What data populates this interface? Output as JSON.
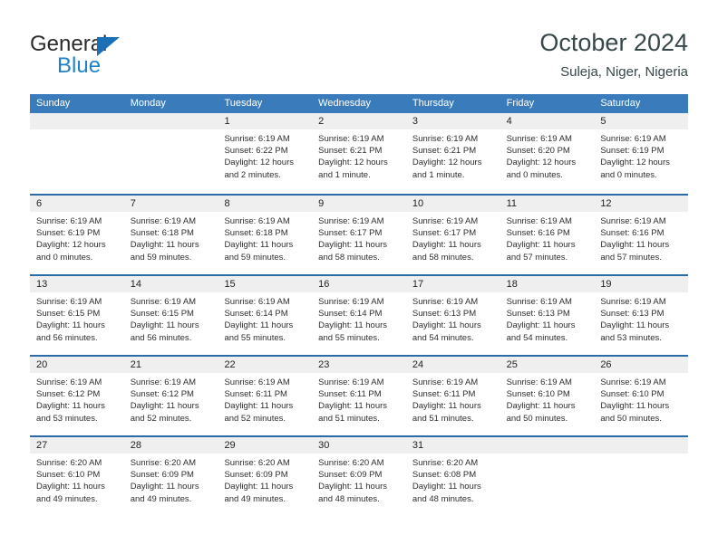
{
  "brand": {
    "name_primary": "General",
    "name_secondary": "Blue",
    "accent_color": "#2081c8",
    "triangle_color": "#1a6fb5"
  },
  "header": {
    "title": "October 2024",
    "location": "Suleja, Niger, Nigeria"
  },
  "theme": {
    "weekday_header_bg": "#3a7cbb",
    "week_divider": "#2b6ca8",
    "day_band_bg": "#efefef"
  },
  "weekdays": [
    "Sunday",
    "Monday",
    "Tuesday",
    "Wednesday",
    "Thursday",
    "Friday",
    "Saturday"
  ],
  "labels": {
    "sunrise_prefix": "Sunrise:",
    "sunset_prefix": "Sunset:",
    "daylight_prefix": "Daylight:"
  },
  "weeks": [
    [
      {
        "day": "",
        "empty": true,
        "line1": "",
        "line2": "",
        "line3": "",
        "line4": ""
      },
      {
        "day": "",
        "empty": true,
        "line1": "",
        "line2": "",
        "line3": "",
        "line4": ""
      },
      {
        "day": "1",
        "empty": false,
        "line1": "Sunrise: 6:19 AM",
        "line2": "Sunset: 6:22 PM",
        "line3": "Daylight: 12 hours",
        "line4": "and 2 minutes."
      },
      {
        "day": "2",
        "empty": false,
        "line1": "Sunrise: 6:19 AM",
        "line2": "Sunset: 6:21 PM",
        "line3": "Daylight: 12 hours",
        "line4": "and 1 minute."
      },
      {
        "day": "3",
        "empty": false,
        "line1": "Sunrise: 6:19 AM",
        "line2": "Sunset: 6:21 PM",
        "line3": "Daylight: 12 hours",
        "line4": "and 1 minute."
      },
      {
        "day": "4",
        "empty": false,
        "line1": "Sunrise: 6:19 AM",
        "line2": "Sunset: 6:20 PM",
        "line3": "Daylight: 12 hours",
        "line4": "and 0 minutes."
      },
      {
        "day": "5",
        "empty": false,
        "line1": "Sunrise: 6:19 AM",
        "line2": "Sunset: 6:19 PM",
        "line3": "Daylight: 12 hours",
        "line4": "and 0 minutes."
      }
    ],
    [
      {
        "day": "6",
        "empty": false,
        "line1": "Sunrise: 6:19 AM",
        "line2": "Sunset: 6:19 PM",
        "line3": "Daylight: 12 hours",
        "line4": "and 0 minutes."
      },
      {
        "day": "7",
        "empty": false,
        "line1": "Sunrise: 6:19 AM",
        "line2": "Sunset: 6:18 PM",
        "line3": "Daylight: 11 hours",
        "line4": "and 59 minutes."
      },
      {
        "day": "8",
        "empty": false,
        "line1": "Sunrise: 6:19 AM",
        "line2": "Sunset: 6:18 PM",
        "line3": "Daylight: 11 hours",
        "line4": "and 59 minutes."
      },
      {
        "day": "9",
        "empty": false,
        "line1": "Sunrise: 6:19 AM",
        "line2": "Sunset: 6:17 PM",
        "line3": "Daylight: 11 hours",
        "line4": "and 58 minutes."
      },
      {
        "day": "10",
        "empty": false,
        "line1": "Sunrise: 6:19 AM",
        "line2": "Sunset: 6:17 PM",
        "line3": "Daylight: 11 hours",
        "line4": "and 58 minutes."
      },
      {
        "day": "11",
        "empty": false,
        "line1": "Sunrise: 6:19 AM",
        "line2": "Sunset: 6:16 PM",
        "line3": "Daylight: 11 hours",
        "line4": "and 57 minutes."
      },
      {
        "day": "12",
        "empty": false,
        "line1": "Sunrise: 6:19 AM",
        "line2": "Sunset: 6:16 PM",
        "line3": "Daylight: 11 hours",
        "line4": "and 57 minutes."
      }
    ],
    [
      {
        "day": "13",
        "empty": false,
        "line1": "Sunrise: 6:19 AM",
        "line2": "Sunset: 6:15 PM",
        "line3": "Daylight: 11 hours",
        "line4": "and 56 minutes."
      },
      {
        "day": "14",
        "empty": false,
        "line1": "Sunrise: 6:19 AM",
        "line2": "Sunset: 6:15 PM",
        "line3": "Daylight: 11 hours",
        "line4": "and 56 minutes."
      },
      {
        "day": "15",
        "empty": false,
        "line1": "Sunrise: 6:19 AM",
        "line2": "Sunset: 6:14 PM",
        "line3": "Daylight: 11 hours",
        "line4": "and 55 minutes."
      },
      {
        "day": "16",
        "empty": false,
        "line1": "Sunrise: 6:19 AM",
        "line2": "Sunset: 6:14 PM",
        "line3": "Daylight: 11 hours",
        "line4": "and 55 minutes."
      },
      {
        "day": "17",
        "empty": false,
        "line1": "Sunrise: 6:19 AM",
        "line2": "Sunset: 6:13 PM",
        "line3": "Daylight: 11 hours",
        "line4": "and 54 minutes."
      },
      {
        "day": "18",
        "empty": false,
        "line1": "Sunrise: 6:19 AM",
        "line2": "Sunset: 6:13 PM",
        "line3": "Daylight: 11 hours",
        "line4": "and 54 minutes."
      },
      {
        "day": "19",
        "empty": false,
        "line1": "Sunrise: 6:19 AM",
        "line2": "Sunset: 6:13 PM",
        "line3": "Daylight: 11 hours",
        "line4": "and 53 minutes."
      }
    ],
    [
      {
        "day": "20",
        "empty": false,
        "line1": "Sunrise: 6:19 AM",
        "line2": "Sunset: 6:12 PM",
        "line3": "Daylight: 11 hours",
        "line4": "and 53 minutes."
      },
      {
        "day": "21",
        "empty": false,
        "line1": "Sunrise: 6:19 AM",
        "line2": "Sunset: 6:12 PM",
        "line3": "Daylight: 11 hours",
        "line4": "and 52 minutes."
      },
      {
        "day": "22",
        "empty": false,
        "line1": "Sunrise: 6:19 AM",
        "line2": "Sunset: 6:11 PM",
        "line3": "Daylight: 11 hours",
        "line4": "and 52 minutes."
      },
      {
        "day": "23",
        "empty": false,
        "line1": "Sunrise: 6:19 AM",
        "line2": "Sunset: 6:11 PM",
        "line3": "Daylight: 11 hours",
        "line4": "and 51 minutes."
      },
      {
        "day": "24",
        "empty": false,
        "line1": "Sunrise: 6:19 AM",
        "line2": "Sunset: 6:11 PM",
        "line3": "Daylight: 11 hours",
        "line4": "and 51 minutes."
      },
      {
        "day": "25",
        "empty": false,
        "line1": "Sunrise: 6:19 AM",
        "line2": "Sunset: 6:10 PM",
        "line3": "Daylight: 11 hours",
        "line4": "and 50 minutes."
      },
      {
        "day": "26",
        "empty": false,
        "line1": "Sunrise: 6:19 AM",
        "line2": "Sunset: 6:10 PM",
        "line3": "Daylight: 11 hours",
        "line4": "and 50 minutes."
      }
    ],
    [
      {
        "day": "27",
        "empty": false,
        "line1": "Sunrise: 6:20 AM",
        "line2": "Sunset: 6:10 PM",
        "line3": "Daylight: 11 hours",
        "line4": "and 49 minutes."
      },
      {
        "day": "28",
        "empty": false,
        "line1": "Sunrise: 6:20 AM",
        "line2": "Sunset: 6:09 PM",
        "line3": "Daylight: 11 hours",
        "line4": "and 49 minutes."
      },
      {
        "day": "29",
        "empty": false,
        "line1": "Sunrise: 6:20 AM",
        "line2": "Sunset: 6:09 PM",
        "line3": "Daylight: 11 hours",
        "line4": "and 49 minutes."
      },
      {
        "day": "30",
        "empty": false,
        "line1": "Sunrise: 6:20 AM",
        "line2": "Sunset: 6:09 PM",
        "line3": "Daylight: 11 hours",
        "line4": "and 48 minutes."
      },
      {
        "day": "31",
        "empty": false,
        "line1": "Sunrise: 6:20 AM",
        "line2": "Sunset: 6:08 PM",
        "line3": "Daylight: 11 hours",
        "line4": "and 48 minutes."
      },
      {
        "day": "",
        "empty": true,
        "line1": "",
        "line2": "",
        "line3": "",
        "line4": ""
      },
      {
        "day": "",
        "empty": true,
        "line1": "",
        "line2": "",
        "line3": "",
        "line4": ""
      }
    ]
  ]
}
